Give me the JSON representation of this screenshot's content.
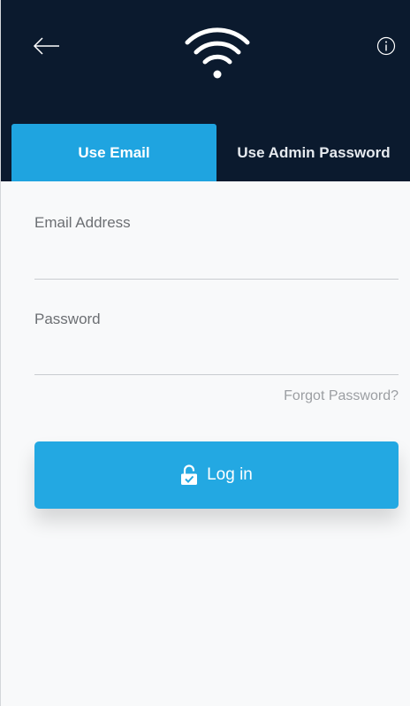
{
  "header": {
    "back_icon": "arrow-left-icon",
    "logo_icon": "wifi-icon",
    "info_icon": "info-icon"
  },
  "tabs": [
    {
      "label": "Use Email",
      "active": true
    },
    {
      "label": "Use Admin Password",
      "active": false
    }
  ],
  "form": {
    "email_label": "Email Address",
    "email_value": "",
    "password_label": "Password",
    "password_value": "",
    "forgot_label": "Forgot Password?",
    "login_label": "Log in",
    "login_icon": "unlock-icon"
  },
  "colors": {
    "header_bg": "#0b1a2e",
    "accent": "#1fa4e0",
    "page_bg": "#f8f9fa"
  }
}
